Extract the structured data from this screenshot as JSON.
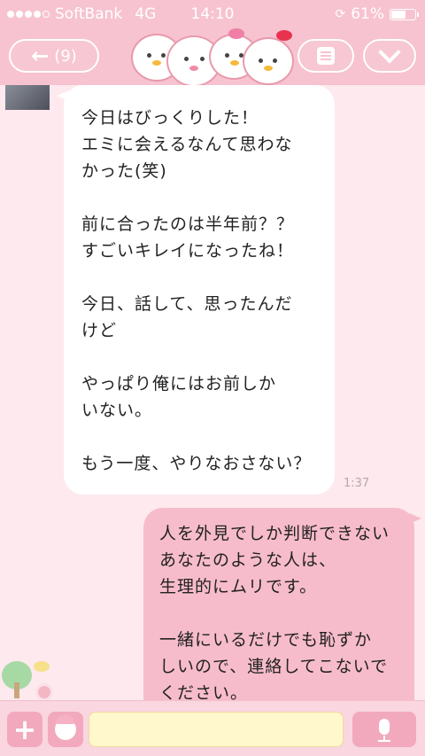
{
  "status_bar": {
    "carrier": "SoftBank",
    "network": "4G",
    "time": "14:10",
    "battery": "61%",
    "battery_level": 0.61,
    "signal_bars": 4
  },
  "header": {
    "back_label": "(9)",
    "back_icon": "arrow-left-icon",
    "menu_icon": "menu-icon",
    "down_icon": "chevron-down-icon"
  },
  "messages": [
    {
      "direction": "incoming",
      "text": "今日はびっくりした！\nエミに会えるなんて思わな\nかった(笑)\n\n前に合ったのは半年前？？\nすごいキレイになったね！\n\n今日、話して、思ったんだ\nけど\n\nやっぱり俺にはお前しか\nいない。\n\nもう一度、やりなおさない？",
      "time": "1:37"
    },
    {
      "direction": "outgoing",
      "text": "人を外見でしか判断できない\nあなたのような人は、\n生理的にムリです。\n\n一緒にいるだけでも恥ずか\nしいので、連絡してこないで\nください。"
    }
  ],
  "input_bar": {
    "plus_label": "+",
    "sticker_icon": "sticker-icon",
    "mic_icon": "mic-icon",
    "input_value": ""
  },
  "colors": {
    "header_bg": "#f7c3d0",
    "chat_bg": "#fde9ee",
    "outgoing_bubble": "#f7bccb",
    "incoming_bubble": "#ffffff",
    "input_bg": "#fff8cc"
  }
}
